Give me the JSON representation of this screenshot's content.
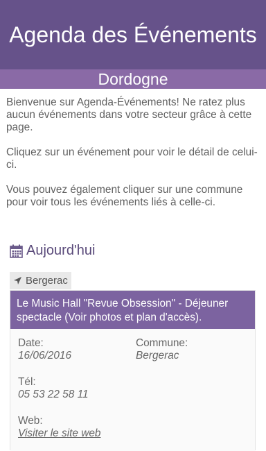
{
  "header": {
    "title": "Agenda des Événements",
    "subtitle": "Dordogne"
  },
  "intro": {
    "p1": "Bienvenue sur Agenda-Événements! Ne ratez plus aucun événements dans votre secteur grâce à cette page.",
    "p2": "Cliquez sur un événement pour voir le détail de celui-ci.",
    "p3": "Vous pouvez également cliquer sur une commune pour voir tous les événements liés à celle-ci."
  },
  "section": {
    "title": "Aujourd'hui",
    "icon": "calendar-icon"
  },
  "location_tag": {
    "label": "Bergerac",
    "icon": "location-arrow-icon"
  },
  "event": {
    "title": "Le Music Hall \"Revue Obsession\" - Déjeuner spectacle (Voir photos et plan d'accès).",
    "date_label": "Date:",
    "date_value": "16/06/2016",
    "commune_label": "Commune:",
    "commune_value": "Bergerac",
    "tel_label": "Tél:",
    "tel_value": "05 53 22 58 11",
    "web_label": "Web:",
    "web_link": "Visiter le site web"
  },
  "colors": {
    "header_bg": "#66528a",
    "subheader_bg": "#8a6aa6",
    "event_title_bg": "#7c63a0"
  }
}
